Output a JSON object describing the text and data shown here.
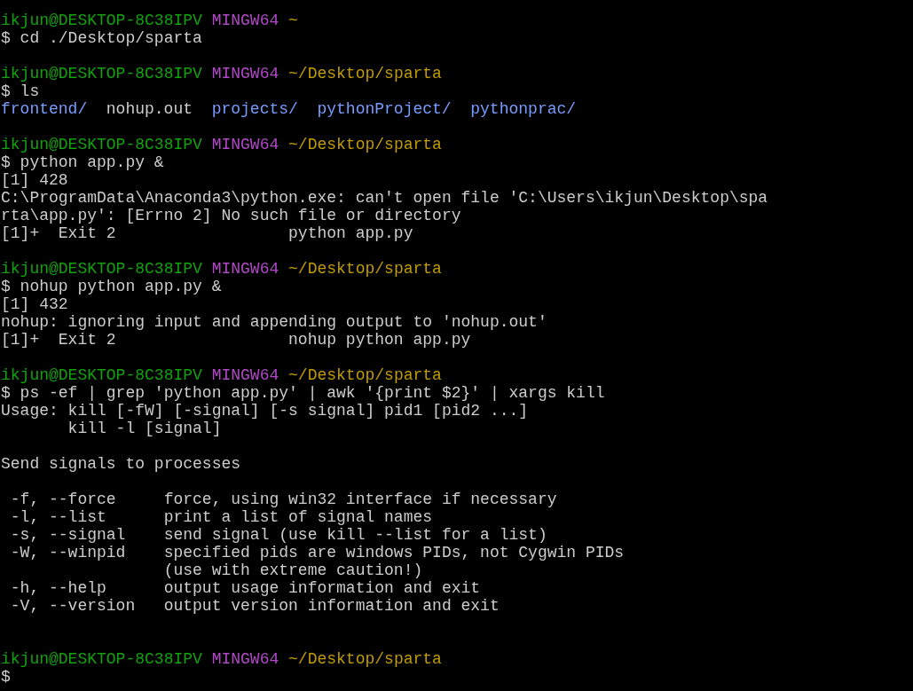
{
  "terminal": {
    "blocks": [
      {
        "prompt": {
          "user_host": "ikjun@DESKTOP-8C38IPV",
          "shell": "MINGW64",
          "path": "~"
        },
        "command": "$ cd ./Desktop/sparta"
      },
      {
        "prompt": {
          "user_host": "ikjun@DESKTOP-8C38IPV",
          "shell": "MINGW64",
          "path": "~/Desktop/sparta"
        },
        "command": "$ ls",
        "output": [
          {
            "kind": "listing",
            "entries": [
              {
                "name": "frontend/",
                "kind": "dir"
              },
              {
                "name": "nohup.out",
                "kind": "file"
              },
              {
                "name": "projects/",
                "kind": "dir"
              },
              {
                "name": "pythonProject/",
                "kind": "dir"
              },
              {
                "name": "pythonprac/",
                "kind": "dir"
              }
            ]
          }
        ]
      },
      {
        "prompt": {
          "user_host": "ikjun@DESKTOP-8C38IPV",
          "shell": "MINGW64",
          "path": "~/Desktop/sparta"
        },
        "command": "$ python app.py &",
        "output": [
          {
            "kind": "text",
            "text": "[1] 428"
          },
          {
            "kind": "text",
            "text": "C:\\ProgramData\\Anaconda3\\python.exe: can't open file 'C:\\Users\\ikjun\\Desktop\\spa"
          },
          {
            "kind": "text",
            "text": "rta\\app.py': [Errno 2] No such file or directory"
          },
          {
            "kind": "text",
            "text": "[1]+  Exit 2                  python app.py"
          }
        ]
      },
      {
        "prompt": {
          "user_host": "ikjun@DESKTOP-8C38IPV",
          "shell": "MINGW64",
          "path": "~/Desktop/sparta"
        },
        "command": "$ nohup python app.py &",
        "output": [
          {
            "kind": "text",
            "text": "[1] 432"
          },
          {
            "kind": "text",
            "text": "nohup: ignoring input and appending output to 'nohup.out'"
          },
          {
            "kind": "text",
            "text": "[1]+  Exit 2                  nohup python app.py"
          }
        ]
      },
      {
        "prompt": {
          "user_host": "ikjun@DESKTOP-8C38IPV",
          "shell": "MINGW64",
          "path": "~/Desktop/sparta"
        },
        "command": "$ ps -ef | grep 'python app.py' | awk '{print $2}' | xargs kill",
        "output": [
          {
            "kind": "text",
            "text": "Usage: kill [-fW] [-signal] [-s signal] pid1 [pid2 ...]"
          },
          {
            "kind": "text",
            "text": "       kill -l [signal]"
          },
          {
            "kind": "blank"
          },
          {
            "kind": "text",
            "text": "Send signals to processes"
          },
          {
            "kind": "blank"
          },
          {
            "kind": "text",
            "text": " -f, --force     force, using win32 interface if necessary"
          },
          {
            "kind": "text",
            "text": " -l, --list      print a list of signal names"
          },
          {
            "kind": "text",
            "text": " -s, --signal    send signal (use kill --list for a list)"
          },
          {
            "kind": "text",
            "text": " -W, --winpid    specified pids are windows PIDs, not Cygwin PIDs"
          },
          {
            "kind": "text",
            "text": "                 (use with extreme caution!)"
          },
          {
            "kind": "text",
            "text": " -h, --help      output usage information and exit"
          },
          {
            "kind": "text",
            "text": " -V, --version   output version information and exit"
          },
          {
            "kind": "blank"
          }
        ]
      },
      {
        "prompt": {
          "user_host": "ikjun@DESKTOP-8C38IPV",
          "shell": "MINGW64",
          "path": "~/Desktop/sparta"
        },
        "command": "$"
      }
    ]
  }
}
